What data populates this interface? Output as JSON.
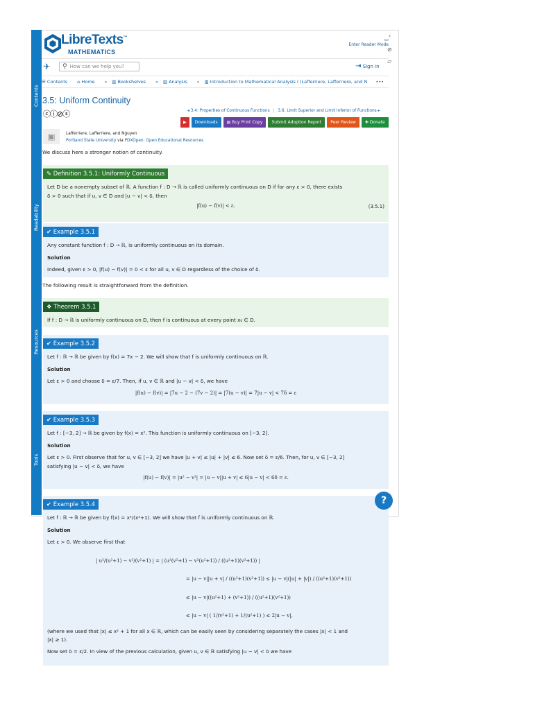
{
  "header": {
    "logo_main": "LibreTexts",
    "logo_tm": "™",
    "logo_sub": "MATHEMATICS",
    "reader_mode": "Enter Reader Mode",
    "search_placeholder": "How can we help you?",
    "sign_in": "Sign in"
  },
  "sidebar": {
    "tabs": [
      "Contents",
      "Readability",
      "Resources",
      "Tools"
    ]
  },
  "breadcrumb": {
    "items": [
      "Contents",
      "Home",
      "Bookshelves",
      "Analysis",
      "Introduction to Mathematical Analysis I (Lafferriere, Lafferriere, and N"
    ],
    "separators": [
      "»",
      "»",
      "»",
      "»"
    ],
    "more": "•••"
  },
  "page": {
    "title": "3.5: Uniform Continuity",
    "license_icons": "ⒸⒸⒸⒸ",
    "prev": "◂ 3.4: Properties of Continuous Functions",
    "next": "3.6: Limit Superior and Limit Inferior of Functions ▸",
    "buttons": {
      "downloads": "Downloads",
      "buy_print": "Buy Print Copy",
      "adoption": "Submit Adoption Report",
      "peer_review": "Peer Review",
      "donate": "Donate"
    },
    "authors": "Lafferriere, Lafferriere, and Nguyen",
    "institution": "Portland State University",
    "via": " via ",
    "source": "PDXOpen: Open Educational Resources",
    "intro": "We discuss here a stronger notion of continuity.",
    "between_text": "The following result is straightforward from the definition."
  },
  "definition": {
    "label": "Definition 3.5.1: Uniformly Continuous",
    "text1": "Let D be a nonempty subset of ℝ. A function f : D → ℝ is called uniformly continuous on D if for any ε > 0, there exists",
    "text2": "δ > 0 such that if u, v ∈ D and |u − v| < δ, then",
    "eq": "|f(u) − f(v)| < ε.",
    "eqnum": "(3.5.1)"
  },
  "example1": {
    "label": "Example 3.5.1",
    "text": "Any constant function f : D → ℝ, is uniformly continuous on its domain.",
    "solution": "Solution",
    "sol_text": "Indeed, given ε > 0, |f(u) − f(v)| = 0 < ε for all u, v ∈ D regardless of the choice of δ."
  },
  "theorem": {
    "label": "Theorem 3.5.1",
    "text": "If f : D → ℝ is uniformly continuous on D, then f is continuous at every point x₀ ∈ D."
  },
  "example2": {
    "label": "Example 3.5.2",
    "text": "Let f : ℝ → ℝ be given by f(x) = 7x − 2. We will show that f is uniformly continuous on ℝ.",
    "solution": "Solution",
    "sol_text": "Let ε > 0 and choose δ = ε/7. Then, if u, v ∈ ℝ and |u − v| < δ, we have",
    "eq": "|f(u) − f(v)| = |7u − 2 − (7v − 2)| = |7(u − v)| = 7|u − v| < 7δ = ε"
  },
  "example3": {
    "label": "Example 3.5.3",
    "text": "Let f : [−3, 2] → ℝ be given by f(x) = x². This function is uniformly continuous on [−3, 2].",
    "solution": "Solution",
    "sol_text1": "Let ε > 0. First observe that for u, v ∈ [−3, 2] we have |u + v| ≤ |u| + |v| ≤ 6. Now set δ = ε/6. Then, for u, v ∈ [−3, 2]",
    "sol_text2": "satisfying |u − v| < δ, we have",
    "eq": "|f(u) − f(v)| = |u² − v²| = |u − v||u + v| ≤ 6|u − v| < 6δ = ε."
  },
  "example4": {
    "label": "Example 3.5.4",
    "text": "Let f : ℝ → ℝ be given by f(x) = x²/(x²+1). We will show that f is uniformly continuous on ℝ.",
    "solution": "Solution",
    "sol_text": "Let ε > 0. We observe first that",
    "eq1": "| u²/(u²+1) − v²/(v²+1) | = | (u²(v²+1) − v²(u²+1)) / ((u²+1)(v²+1)) |",
    "eq2": "= |u − v||u + v| / ((u²+1)(v²+1)) ≤ |u − v|(|u| + |v|) / ((u²+1)(v²+1))",
    "eq3": "≤ |u − v|((u²+1) + (v²+1)) / ((u²+1)(v²+1))",
    "eq4": "≤ |u − v| ( 1/(v²+1) + 1/(u²+1) ) ≤ 2|u − v|,",
    "after1": "(where we used that |x| ≤ x² + 1 for all x ∈ ℝ, which can be easily seen by considering separately the cases |x| < 1 and",
    "after2": "|x| ≥ 1).",
    "after3": "Now set δ = ε/2. In view of the previous calculation, given u, v ∈ ℝ satisfying |u − v| < δ we have"
  },
  "help": "?"
}
